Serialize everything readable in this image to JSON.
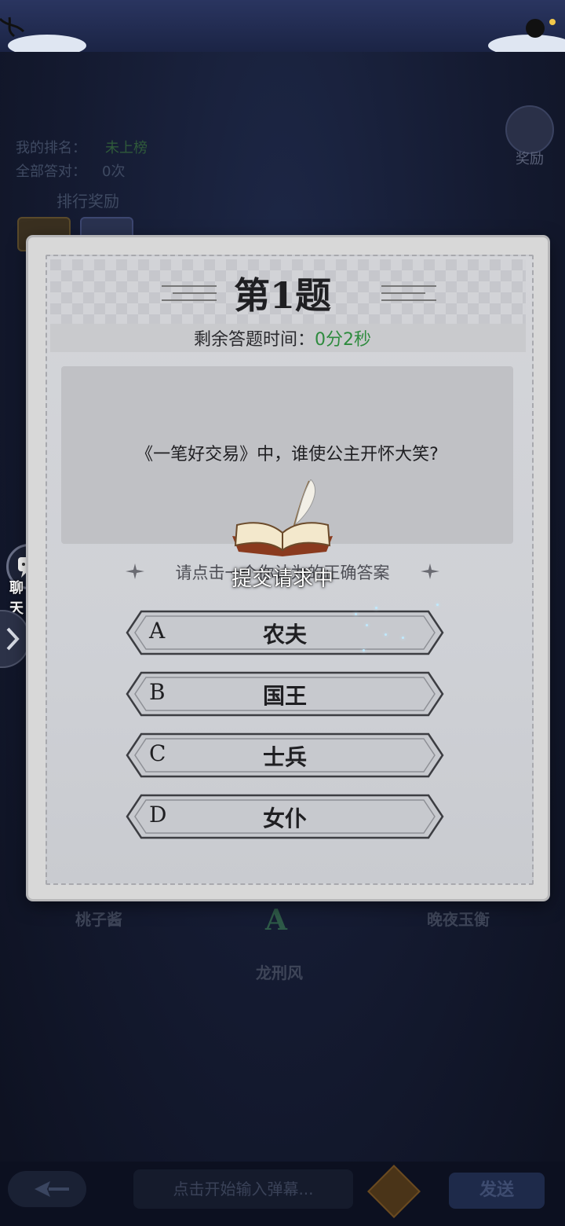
{
  "background": {
    "rank_label": "我的排名：",
    "rank_value": "未上榜",
    "all_correct_label": "全部答对：",
    "all_correct_value": "0次",
    "ranking_reward": "排行奖励",
    "reward_button": "奖励",
    "chat_label": "聊 天",
    "players": [
      "桃子酱",
      "龙刑风",
      "晚夜玉衡"
    ],
    "rank_badge": "A"
  },
  "quiz": {
    "title": "第1题",
    "timer_label": "剩余答题时间：",
    "timer_value": "0分2秒",
    "question": "《一笔好交易》中，谁使公主开怀大笑?",
    "hint": "请点击一个你认为的正确答案",
    "options": [
      {
        "letter": "A",
        "text": "农夫"
      },
      {
        "letter": "B",
        "text": "国王"
      },
      {
        "letter": "C",
        "text": "士兵"
      },
      {
        "letter": "D",
        "text": "女仆"
      }
    ]
  },
  "loading": {
    "text": "提交请求中",
    "icon": "open-book-quill-icon"
  },
  "bottom_bar": {
    "input_placeholder": "点击开始输入弹幕...",
    "send_label": "发送"
  },
  "colors": {
    "timer_green": "#2e8b3e",
    "dialog_paper": "#d4d5d9",
    "scene_dark": "#141a30"
  }
}
